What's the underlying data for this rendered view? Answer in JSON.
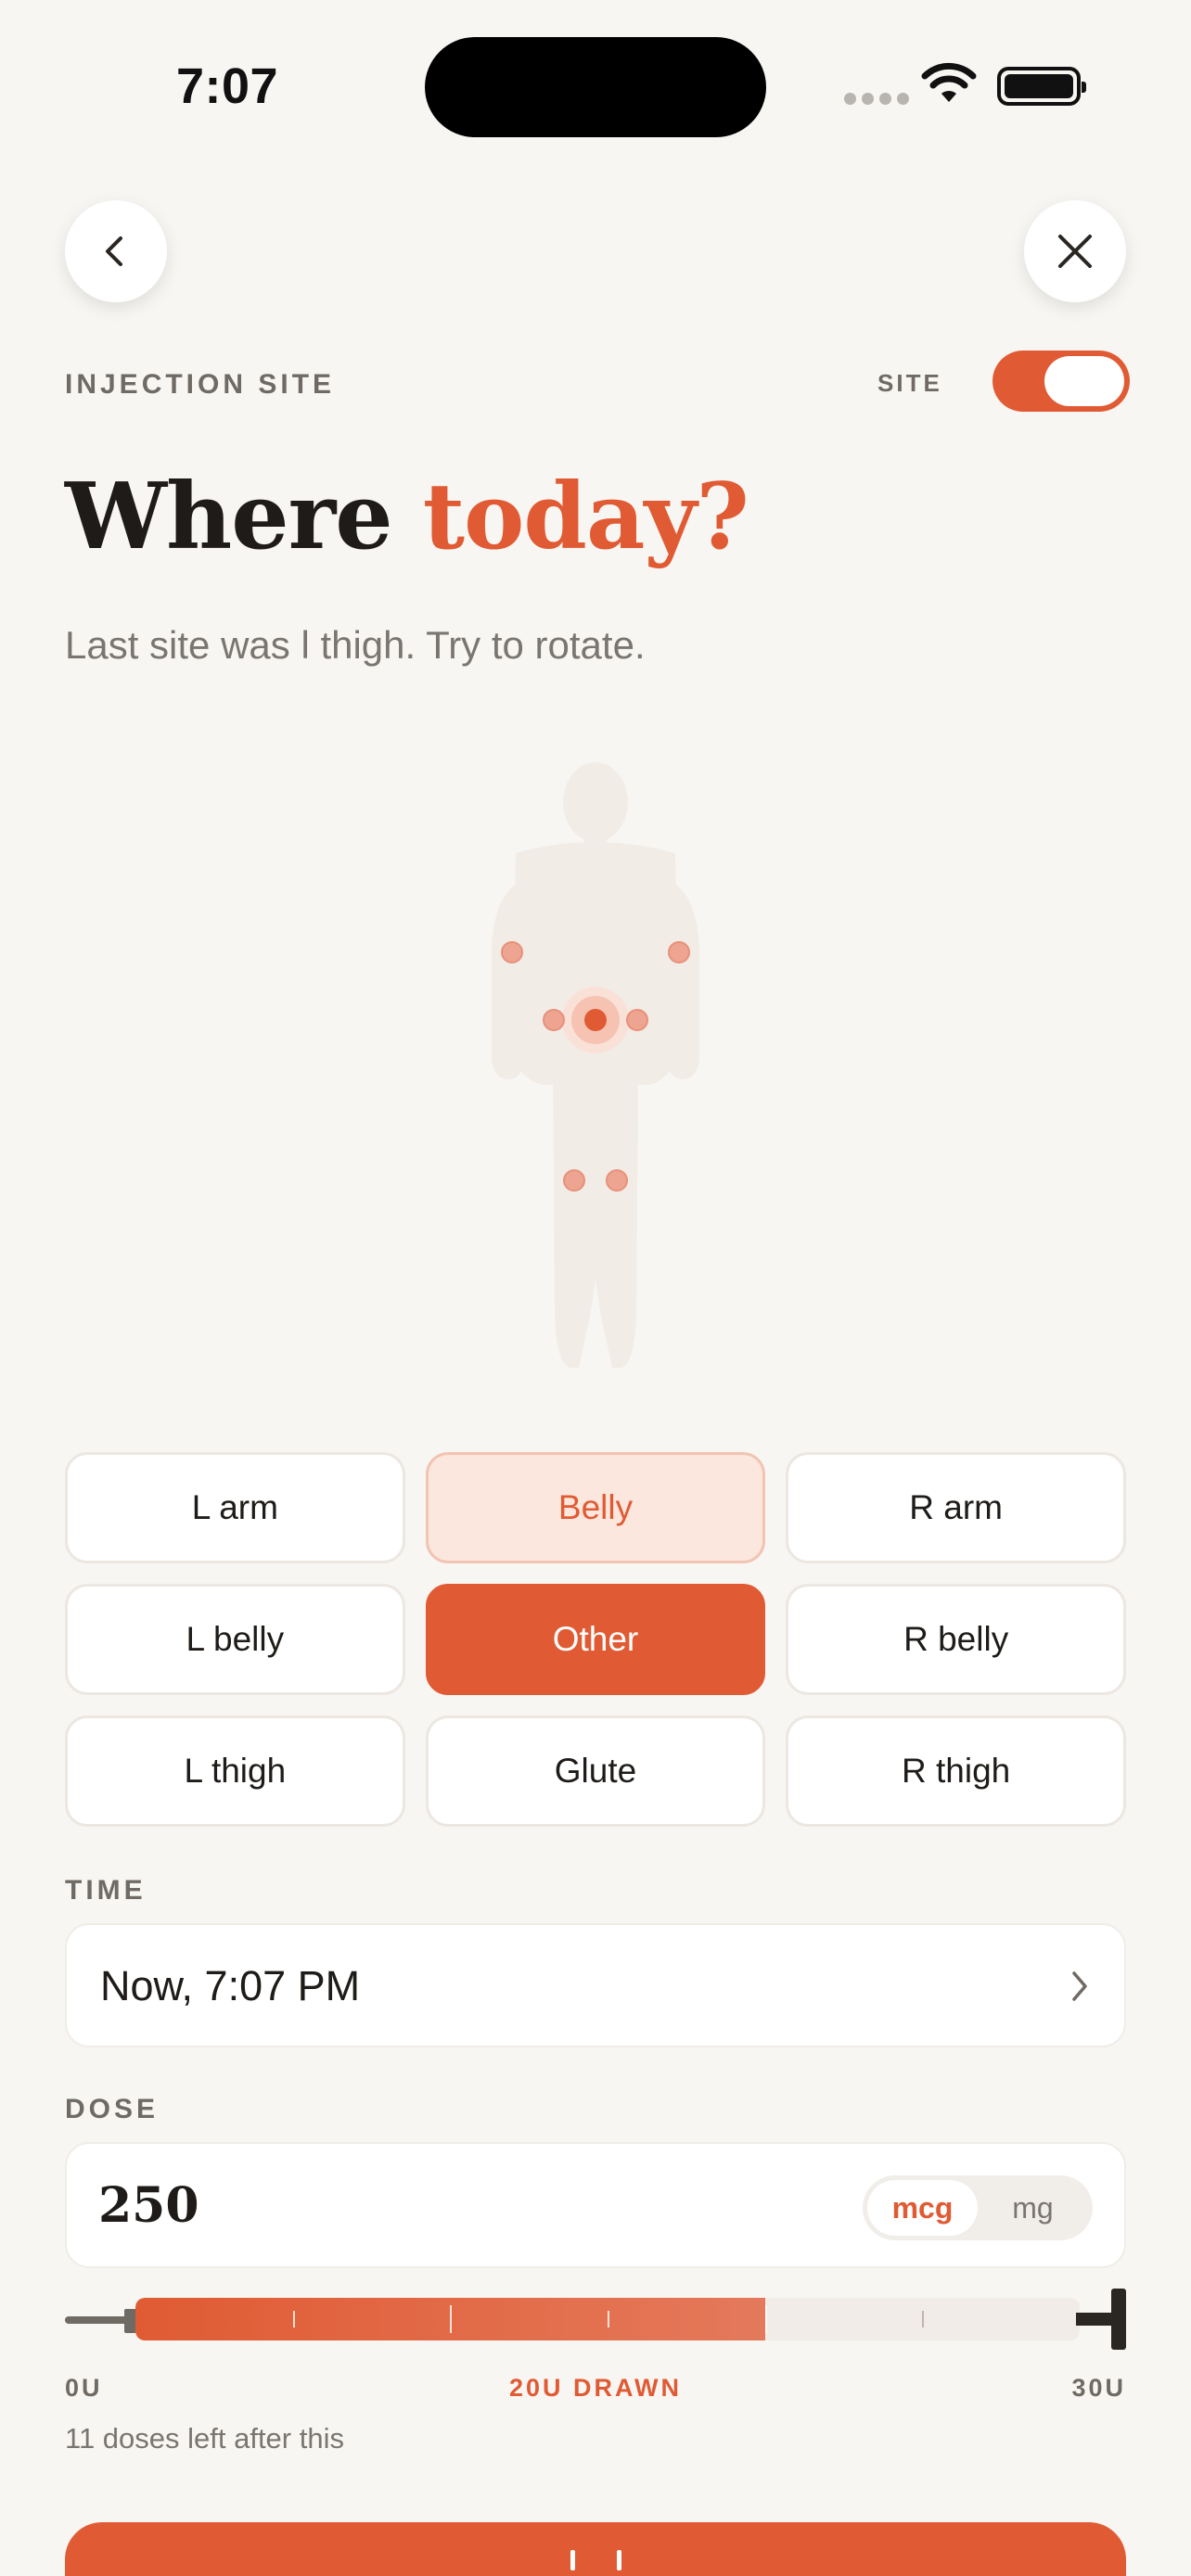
{
  "status_bar": {
    "time": "7:07"
  },
  "header": {
    "section_label": "INJECTION SITE",
    "toggle_label": "SITE",
    "toggle_on": true,
    "title_main": "Where",
    "title_accent": "today?",
    "subtitle": "Last site was l thigh. Try to rotate."
  },
  "icons": {
    "back": "chevron-left-icon",
    "close": "close-icon",
    "time_chevron": "chevron-right-icon"
  },
  "sites": [
    {
      "label": "L arm",
      "state": "default"
    },
    {
      "label": "Belly",
      "state": "suggested"
    },
    {
      "label": "R arm",
      "state": "default"
    },
    {
      "label": "L belly",
      "state": "default"
    },
    {
      "label": "Other",
      "state": "selected"
    },
    {
      "label": "R belly",
      "state": "default"
    },
    {
      "label": "L thigh",
      "state": "default"
    },
    {
      "label": "Glute",
      "state": "default"
    },
    {
      "label": "R thigh",
      "state": "default"
    }
  ],
  "time": {
    "label": "TIME",
    "value": "Now, 7:07 PM"
  },
  "dose": {
    "label": "DOSE",
    "value": "250",
    "units": [
      "mcg",
      "mg"
    ],
    "selected_unit": "mcg"
  },
  "syringe": {
    "min_label": "0U",
    "max_label": "30U",
    "drawn_label": "20U DRAWN",
    "drawn_units": 20,
    "max_units": 30
  },
  "doses_left": "11 doses left after this",
  "colors": {
    "accent": "#E05B33",
    "accent_soft": "#FCE7DE",
    "background": "#F8F6F3"
  }
}
